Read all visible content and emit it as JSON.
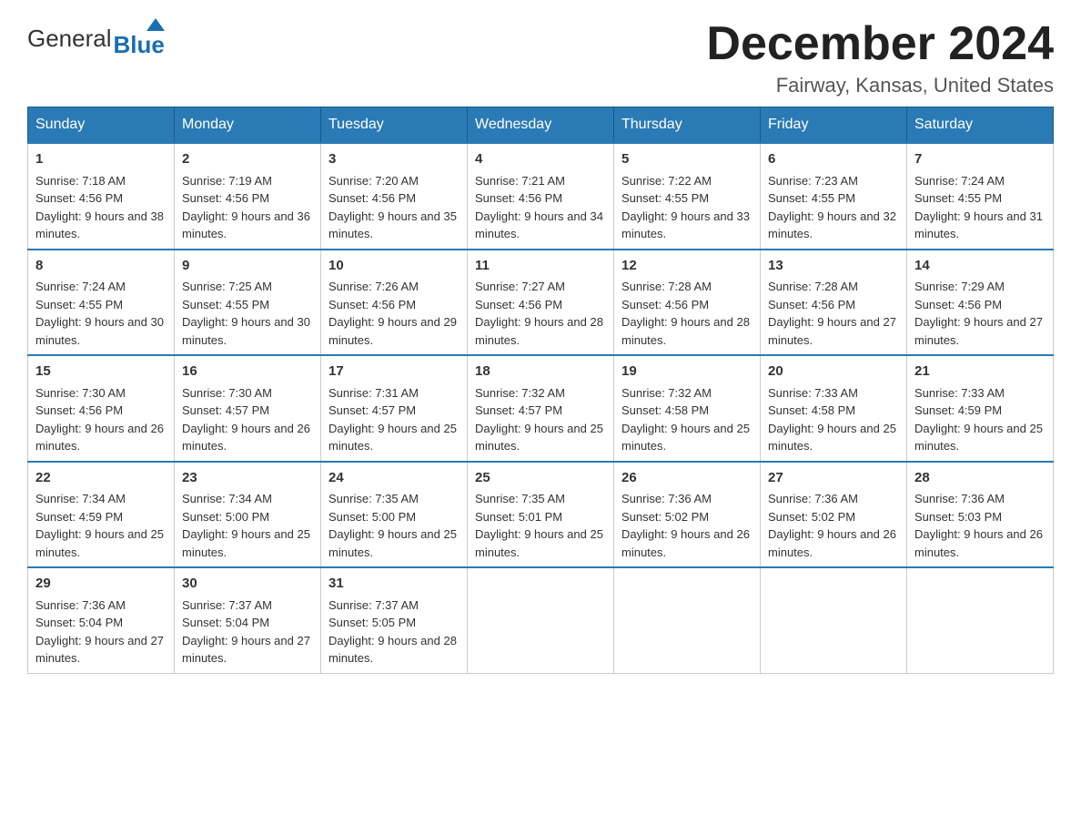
{
  "header": {
    "logo_general": "General",
    "logo_blue": "Blue",
    "month_title": "December 2024",
    "location": "Fairway, Kansas, United States"
  },
  "days_of_week": [
    "Sunday",
    "Monday",
    "Tuesday",
    "Wednesday",
    "Thursday",
    "Friday",
    "Saturday"
  ],
  "weeks": [
    [
      {
        "day": "1",
        "sunrise": "7:18 AM",
        "sunset": "4:56 PM",
        "daylight": "9 hours and 38 minutes."
      },
      {
        "day": "2",
        "sunrise": "7:19 AM",
        "sunset": "4:56 PM",
        "daylight": "9 hours and 36 minutes."
      },
      {
        "day": "3",
        "sunrise": "7:20 AM",
        "sunset": "4:56 PM",
        "daylight": "9 hours and 35 minutes."
      },
      {
        "day": "4",
        "sunrise": "7:21 AM",
        "sunset": "4:56 PM",
        "daylight": "9 hours and 34 minutes."
      },
      {
        "day": "5",
        "sunrise": "7:22 AM",
        "sunset": "4:55 PM",
        "daylight": "9 hours and 33 minutes."
      },
      {
        "day": "6",
        "sunrise": "7:23 AM",
        "sunset": "4:55 PM",
        "daylight": "9 hours and 32 minutes."
      },
      {
        "day": "7",
        "sunrise": "7:24 AM",
        "sunset": "4:55 PM",
        "daylight": "9 hours and 31 minutes."
      }
    ],
    [
      {
        "day": "8",
        "sunrise": "7:24 AM",
        "sunset": "4:55 PM",
        "daylight": "9 hours and 30 minutes."
      },
      {
        "day": "9",
        "sunrise": "7:25 AM",
        "sunset": "4:55 PM",
        "daylight": "9 hours and 30 minutes."
      },
      {
        "day": "10",
        "sunrise": "7:26 AM",
        "sunset": "4:56 PM",
        "daylight": "9 hours and 29 minutes."
      },
      {
        "day": "11",
        "sunrise": "7:27 AM",
        "sunset": "4:56 PM",
        "daylight": "9 hours and 28 minutes."
      },
      {
        "day": "12",
        "sunrise": "7:28 AM",
        "sunset": "4:56 PM",
        "daylight": "9 hours and 28 minutes."
      },
      {
        "day": "13",
        "sunrise": "7:28 AM",
        "sunset": "4:56 PM",
        "daylight": "9 hours and 27 minutes."
      },
      {
        "day": "14",
        "sunrise": "7:29 AM",
        "sunset": "4:56 PM",
        "daylight": "9 hours and 27 minutes."
      }
    ],
    [
      {
        "day": "15",
        "sunrise": "7:30 AM",
        "sunset": "4:56 PM",
        "daylight": "9 hours and 26 minutes."
      },
      {
        "day": "16",
        "sunrise": "7:30 AM",
        "sunset": "4:57 PM",
        "daylight": "9 hours and 26 minutes."
      },
      {
        "day": "17",
        "sunrise": "7:31 AM",
        "sunset": "4:57 PM",
        "daylight": "9 hours and 25 minutes."
      },
      {
        "day": "18",
        "sunrise": "7:32 AM",
        "sunset": "4:57 PM",
        "daylight": "9 hours and 25 minutes."
      },
      {
        "day": "19",
        "sunrise": "7:32 AM",
        "sunset": "4:58 PM",
        "daylight": "9 hours and 25 minutes."
      },
      {
        "day": "20",
        "sunrise": "7:33 AM",
        "sunset": "4:58 PM",
        "daylight": "9 hours and 25 minutes."
      },
      {
        "day": "21",
        "sunrise": "7:33 AM",
        "sunset": "4:59 PM",
        "daylight": "9 hours and 25 minutes."
      }
    ],
    [
      {
        "day": "22",
        "sunrise": "7:34 AM",
        "sunset": "4:59 PM",
        "daylight": "9 hours and 25 minutes."
      },
      {
        "day": "23",
        "sunrise": "7:34 AM",
        "sunset": "5:00 PM",
        "daylight": "9 hours and 25 minutes."
      },
      {
        "day": "24",
        "sunrise": "7:35 AM",
        "sunset": "5:00 PM",
        "daylight": "9 hours and 25 minutes."
      },
      {
        "day": "25",
        "sunrise": "7:35 AM",
        "sunset": "5:01 PM",
        "daylight": "9 hours and 25 minutes."
      },
      {
        "day": "26",
        "sunrise": "7:36 AM",
        "sunset": "5:02 PM",
        "daylight": "9 hours and 26 minutes."
      },
      {
        "day": "27",
        "sunrise": "7:36 AM",
        "sunset": "5:02 PM",
        "daylight": "9 hours and 26 minutes."
      },
      {
        "day": "28",
        "sunrise": "7:36 AM",
        "sunset": "5:03 PM",
        "daylight": "9 hours and 26 minutes."
      }
    ],
    [
      {
        "day": "29",
        "sunrise": "7:36 AM",
        "sunset": "5:04 PM",
        "daylight": "9 hours and 27 minutes."
      },
      {
        "day": "30",
        "sunrise": "7:37 AM",
        "sunset": "5:04 PM",
        "daylight": "9 hours and 27 minutes."
      },
      {
        "day": "31",
        "sunrise": "7:37 AM",
        "sunset": "5:05 PM",
        "daylight": "9 hours and 28 minutes."
      },
      null,
      null,
      null,
      null
    ]
  ],
  "labels": {
    "sunrise": "Sunrise:",
    "sunset": "Sunset:",
    "daylight": "Daylight:"
  }
}
